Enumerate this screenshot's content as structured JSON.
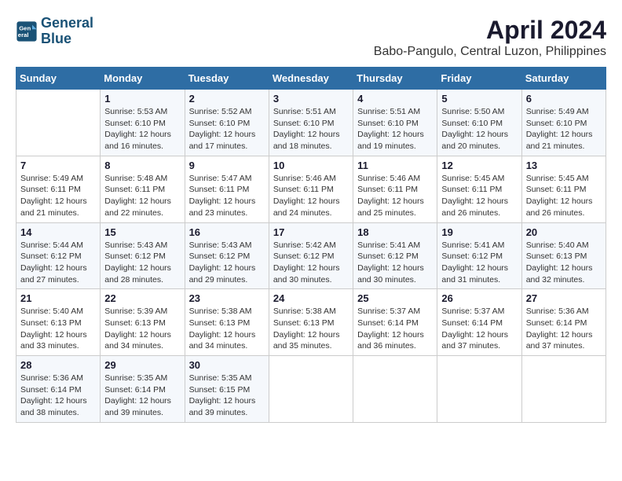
{
  "logo": {
    "line1": "General",
    "line2": "Blue"
  },
  "title": "April 2024",
  "subtitle": "Babo-Pangulo, Central Luzon, Philippines",
  "days_of_week": [
    "Sunday",
    "Monday",
    "Tuesday",
    "Wednesday",
    "Thursday",
    "Friday",
    "Saturday"
  ],
  "weeks": [
    [
      {
        "day": "",
        "info": ""
      },
      {
        "day": "1",
        "info": "Sunrise: 5:53 AM\nSunset: 6:10 PM\nDaylight: 12 hours\nand 16 minutes."
      },
      {
        "day": "2",
        "info": "Sunrise: 5:52 AM\nSunset: 6:10 PM\nDaylight: 12 hours\nand 17 minutes."
      },
      {
        "day": "3",
        "info": "Sunrise: 5:51 AM\nSunset: 6:10 PM\nDaylight: 12 hours\nand 18 minutes."
      },
      {
        "day": "4",
        "info": "Sunrise: 5:51 AM\nSunset: 6:10 PM\nDaylight: 12 hours\nand 19 minutes."
      },
      {
        "day": "5",
        "info": "Sunrise: 5:50 AM\nSunset: 6:10 PM\nDaylight: 12 hours\nand 20 minutes."
      },
      {
        "day": "6",
        "info": "Sunrise: 5:49 AM\nSunset: 6:10 PM\nDaylight: 12 hours\nand 21 minutes."
      }
    ],
    [
      {
        "day": "7",
        "info": "Sunrise: 5:49 AM\nSunset: 6:11 PM\nDaylight: 12 hours\nand 21 minutes."
      },
      {
        "day": "8",
        "info": "Sunrise: 5:48 AM\nSunset: 6:11 PM\nDaylight: 12 hours\nand 22 minutes."
      },
      {
        "day": "9",
        "info": "Sunrise: 5:47 AM\nSunset: 6:11 PM\nDaylight: 12 hours\nand 23 minutes."
      },
      {
        "day": "10",
        "info": "Sunrise: 5:46 AM\nSunset: 6:11 PM\nDaylight: 12 hours\nand 24 minutes."
      },
      {
        "day": "11",
        "info": "Sunrise: 5:46 AM\nSunset: 6:11 PM\nDaylight: 12 hours\nand 25 minutes."
      },
      {
        "day": "12",
        "info": "Sunrise: 5:45 AM\nSunset: 6:11 PM\nDaylight: 12 hours\nand 26 minutes."
      },
      {
        "day": "13",
        "info": "Sunrise: 5:45 AM\nSunset: 6:11 PM\nDaylight: 12 hours\nand 26 minutes."
      }
    ],
    [
      {
        "day": "14",
        "info": "Sunrise: 5:44 AM\nSunset: 6:12 PM\nDaylight: 12 hours\nand 27 minutes."
      },
      {
        "day": "15",
        "info": "Sunrise: 5:43 AM\nSunset: 6:12 PM\nDaylight: 12 hours\nand 28 minutes."
      },
      {
        "day": "16",
        "info": "Sunrise: 5:43 AM\nSunset: 6:12 PM\nDaylight: 12 hours\nand 29 minutes."
      },
      {
        "day": "17",
        "info": "Sunrise: 5:42 AM\nSunset: 6:12 PM\nDaylight: 12 hours\nand 30 minutes."
      },
      {
        "day": "18",
        "info": "Sunrise: 5:41 AM\nSunset: 6:12 PM\nDaylight: 12 hours\nand 30 minutes."
      },
      {
        "day": "19",
        "info": "Sunrise: 5:41 AM\nSunset: 6:12 PM\nDaylight: 12 hours\nand 31 minutes."
      },
      {
        "day": "20",
        "info": "Sunrise: 5:40 AM\nSunset: 6:13 PM\nDaylight: 12 hours\nand 32 minutes."
      }
    ],
    [
      {
        "day": "21",
        "info": "Sunrise: 5:40 AM\nSunset: 6:13 PM\nDaylight: 12 hours\nand 33 minutes."
      },
      {
        "day": "22",
        "info": "Sunrise: 5:39 AM\nSunset: 6:13 PM\nDaylight: 12 hours\nand 34 minutes."
      },
      {
        "day": "23",
        "info": "Sunrise: 5:38 AM\nSunset: 6:13 PM\nDaylight: 12 hours\nand 34 minutes."
      },
      {
        "day": "24",
        "info": "Sunrise: 5:38 AM\nSunset: 6:13 PM\nDaylight: 12 hours\nand 35 minutes."
      },
      {
        "day": "25",
        "info": "Sunrise: 5:37 AM\nSunset: 6:14 PM\nDaylight: 12 hours\nand 36 minutes."
      },
      {
        "day": "26",
        "info": "Sunrise: 5:37 AM\nSunset: 6:14 PM\nDaylight: 12 hours\nand 37 minutes."
      },
      {
        "day": "27",
        "info": "Sunrise: 5:36 AM\nSunset: 6:14 PM\nDaylight: 12 hours\nand 37 minutes."
      }
    ],
    [
      {
        "day": "28",
        "info": "Sunrise: 5:36 AM\nSunset: 6:14 PM\nDaylight: 12 hours\nand 38 minutes."
      },
      {
        "day": "29",
        "info": "Sunrise: 5:35 AM\nSunset: 6:14 PM\nDaylight: 12 hours\nand 39 minutes."
      },
      {
        "day": "30",
        "info": "Sunrise: 5:35 AM\nSunset: 6:15 PM\nDaylight: 12 hours\nand 39 minutes."
      },
      {
        "day": "",
        "info": ""
      },
      {
        "day": "",
        "info": ""
      },
      {
        "day": "",
        "info": ""
      },
      {
        "day": "",
        "info": ""
      }
    ]
  ]
}
